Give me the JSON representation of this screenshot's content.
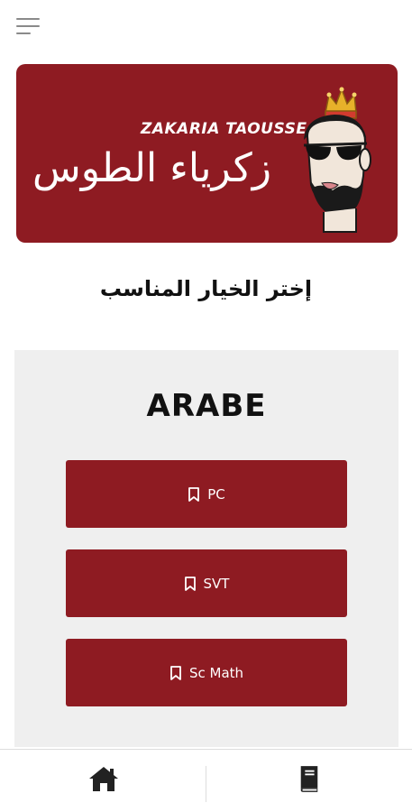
{
  "header": {
    "menu_icon": "hamburger-menu-icon"
  },
  "banner": {
    "latin_name": "ZAKARIA TAOUSSE",
    "arabic_name": "زكرياء الطوس",
    "background_color": "#8e1b22"
  },
  "subtitle": "إختر الخيار المناسب",
  "section": {
    "title": "ARABE",
    "options": [
      {
        "label": "PC",
        "icon": "bookmark-icon"
      },
      {
        "label": "SVT",
        "icon": "bookmark-icon"
      },
      {
        "label": "Sc Math",
        "icon": "bookmark-icon"
      }
    ]
  },
  "bottom_nav": {
    "items": [
      {
        "icon": "home-icon"
      },
      {
        "icon": "book-icon"
      }
    ]
  }
}
